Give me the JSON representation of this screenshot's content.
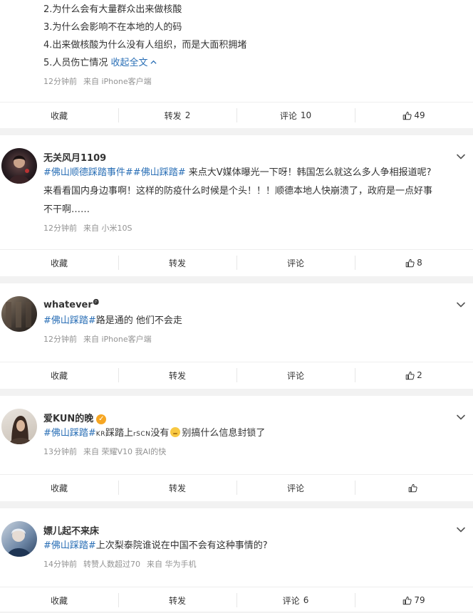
{
  "post0": {
    "lines": [
      "2.为什么会有大量群众出来做核酸",
      "3.为什么会影响不在本地的人的码",
      "4.出来做核酸为什么没有人组织，而是大面积拥堵",
      "5.人员伤亡情况"
    ],
    "collapse_label": "收起全文",
    "meta": {
      "time": "12分钟前",
      "source": "来自 iPhone客户端"
    },
    "actions": {
      "fav": "收藏",
      "repost": "转发",
      "repost_count": "2",
      "comment": "评论",
      "comment_count": "10",
      "like_count": "49"
    }
  },
  "post1": {
    "username": "无关风月1109",
    "topic1": "#佛山顺德踩踏事件#",
    "topic2": "#佛山踩踏#",
    "line1_rest": " 来点大V媒体曝光一下呀！韩国怎么就这么多人争相报道呢?",
    "line2": "来看看国内身边事啊！这样的防疫什么时候是个头！！！顺德本地人快崩溃了，政府是一点好事",
    "line3": "不干啊……",
    "meta": {
      "time": "12分钟前",
      "source": "来自 小米10S"
    },
    "actions": {
      "fav": "收藏",
      "repost": "转发",
      "comment": "评论",
      "like_count": "8"
    }
  },
  "post2": {
    "username": "whatever",
    "username_mark": "🅟",
    "topic": "#佛山踩踏#",
    "text": "路是通的 他们不会走",
    "meta": {
      "time": "12分钟前",
      "source": "来自 iPhone客户端"
    },
    "actions": {
      "fav": "收藏",
      "repost": "转发",
      "comment": "评论",
      "like_count": "2"
    }
  },
  "post3": {
    "username": "爱KUN的晚",
    "vbadge": "✓",
    "topic": "#佛山踩踏#",
    "kr": "KR",
    "text_a": "踩踏上",
    "scn": "rSCN",
    "text_b": "没有",
    "text_c": "别搞什么信息封锁了",
    "meta": {
      "time": "13分钟前",
      "source": "来自 荣耀V10 我AI的快"
    },
    "actions": {
      "fav": "收藏",
      "repost": "转发",
      "comment": "评论"
    }
  },
  "post4": {
    "username": "嫖儿起不来床",
    "topic": "#佛山踩踏#",
    "text": "上次梨泰院谁说在中国不会有这种事情的?",
    "meta": {
      "time": "14分钟前",
      "repost_info": "转赞人数超过70",
      "source": "来自 华为手机"
    },
    "actions": {
      "fav": "收藏",
      "repost": "转发",
      "comment": "评论",
      "comment_count": "6",
      "like_count": "79"
    }
  },
  "colors": {
    "link": "#2a6fb6",
    "meta": "#939393",
    "background": "#f2f2f2"
  }
}
